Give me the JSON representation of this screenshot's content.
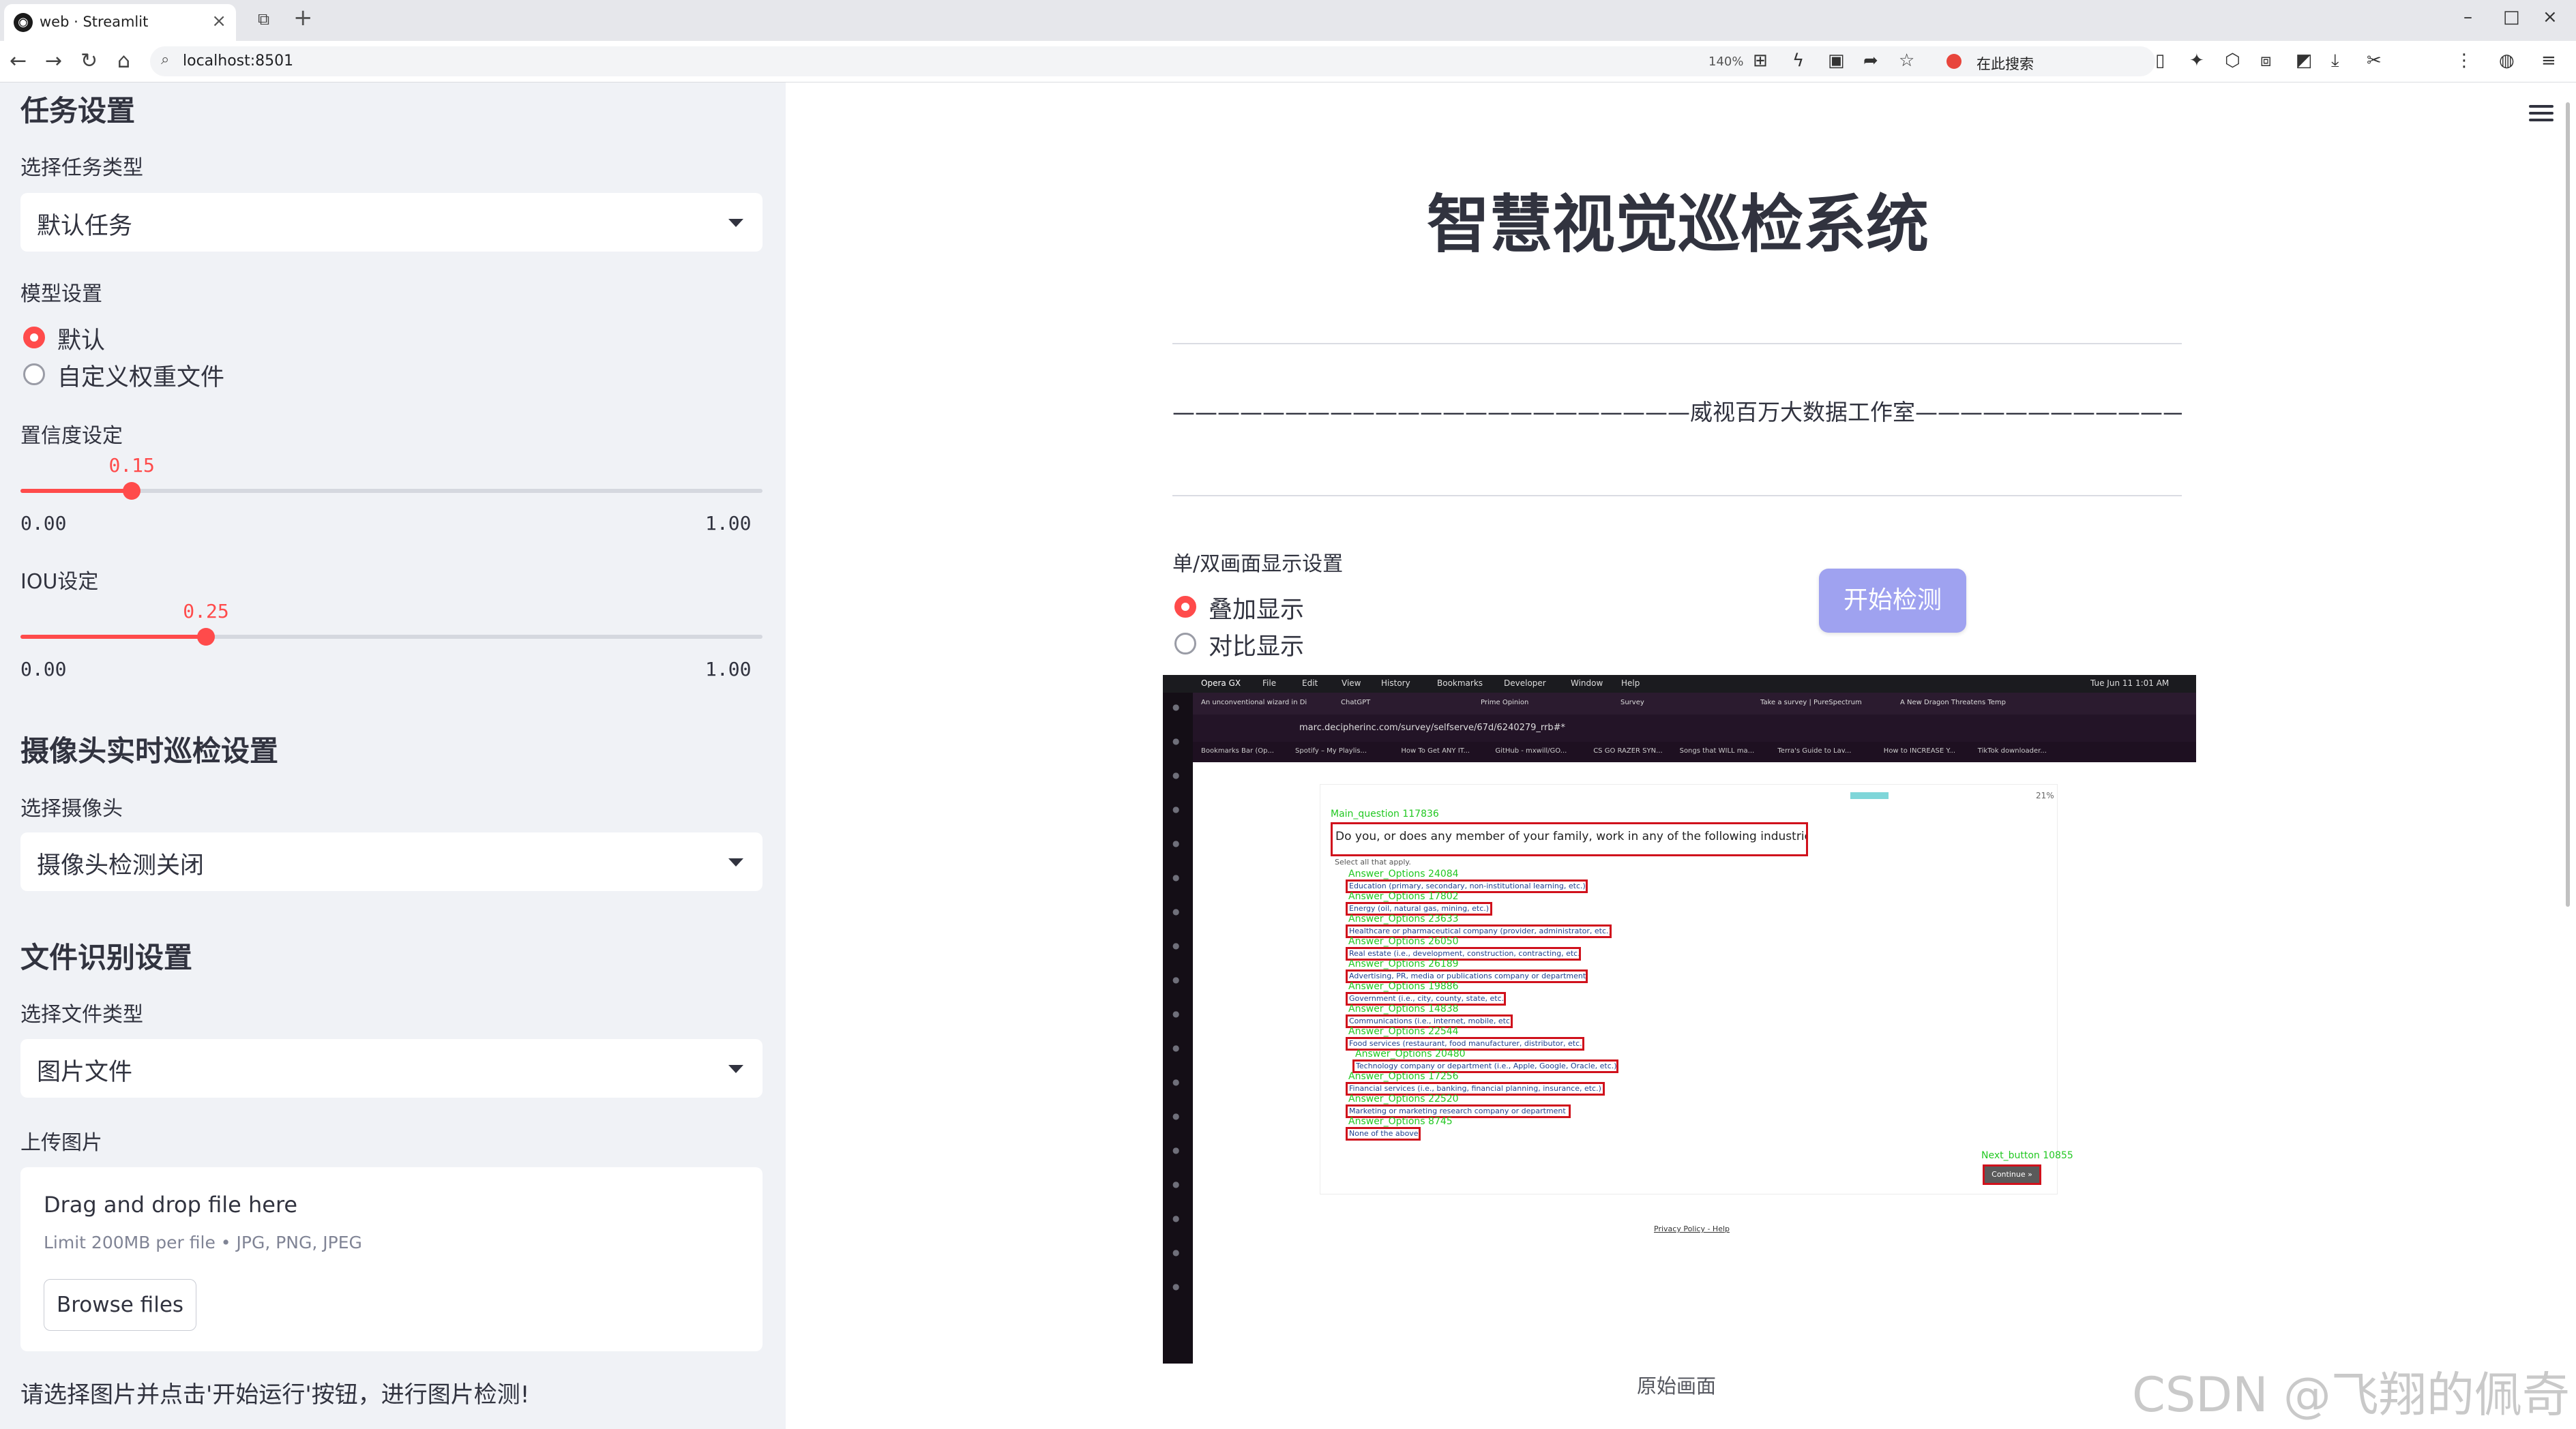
{
  "browser": {
    "tab_title": "web · Streamlit",
    "tab_favicon": "◉",
    "url": "localhost:8501",
    "zoom": "140%",
    "search_placeholder": "在此搜索"
  },
  "sidebar": {
    "task_heading": "任务设置",
    "task_type_label": "选择任务类型",
    "task_type_value": "默认任务",
    "model_heading": "模型设置",
    "model_options": [
      "默认",
      "自定义权重文件"
    ],
    "model_selected": "默认",
    "conf_label": "置信度设定",
    "conf_value": "0.15",
    "conf_level": 0.15,
    "conf_min": "0.00",
    "conf_max": "1.00",
    "iou_label": "IOU设定",
    "iou_value": "0.25",
    "iou_level": 0.25,
    "iou_min": "0.00",
    "iou_max": "1.00",
    "camera_heading": "摄像头实时巡检设置",
    "camera_label": "选择摄像头",
    "camera_value": "摄像头检测关闭",
    "file_heading": "文件识别设置",
    "file_type_label": "选择文件类型",
    "file_type_value": "图片文件",
    "upload_label": "上传图片",
    "drop_title": "Drag and drop file here",
    "drop_limit": "Limit 200MB per file • JPG, PNG, JPEG",
    "browse_label": "Browse files",
    "hint": "请选择图片并点击'开始运行'按钮，进行图片检测!"
  },
  "main": {
    "title": "智慧视觉巡检系统",
    "studio_line": "———————————————————————威视百万大数据工作室———————————————————————",
    "display_label": "单/双画面显示设置",
    "display_options": [
      "叠加显示",
      "对比显示"
    ],
    "display_selected": "叠加显示",
    "start_button": "开始检测",
    "caption": "原始画面",
    "watermark": "CSDN @飞翔的佩奇",
    "accent_color": "#ff4b4b",
    "button_color": "#9fa2f0"
  },
  "screenshot": {
    "menubar": [
      "Opera GX",
      "File",
      "Edit",
      "View",
      "History",
      "Bookmarks",
      "Developer",
      "Window",
      "Help"
    ],
    "clock": "Tue Jun 11  1:01 AM",
    "tabs": [
      "An unconventional wizard in Di",
      "ChatGPT",
      "Prime Opinion",
      "Survey",
      "Take a survey | PureSpectrum",
      "A New Dragon Threatens Temp"
    ],
    "address": "marc.decipherinc.com/survey/selfserve/67d/6240279_rrb#*",
    "bookmarks": [
      "Bookmarks Bar (Op...",
      "Spotify – My Playlis...",
      "How To Get ANY IT...",
      "GitHub - mxwill/GO...",
      "CS GO RAZER SYN...",
      "Songs that WILL ma...",
      "Terra's Guide to Lav...",
      "How to INCREASE Y...",
      "TikTok downloader..."
    ],
    "progress": "21%",
    "question_label": "Main_question  117836",
    "question_text": "Do you, or does any member of your family, work in any of the following industries?",
    "select_all": "Select all that apply.",
    "options": [
      {
        "label": "Answer_Options  24084",
        "text": "Education (primary, secondary, non-institutional learning, etc.)"
      },
      {
        "label": "Answer_Options  17802",
        "text": "Energy (oil, natural gas, mining, etc.)"
      },
      {
        "label": "Answer_Options  23633",
        "text": "Healthcare or pharmaceutical company (provider, administrator, etc.)"
      },
      {
        "label": "Answer_Options  26050",
        "text": "Real estate (i.e., development, construction, contracting, etc.)"
      },
      {
        "label": "Answer_Options  26189",
        "text": "Advertising, PR, media or publications company or department"
      },
      {
        "label": "Answer_Options  19886",
        "text": "Government (i.e., city, county, state, etc.)"
      },
      {
        "label": "Answer_Options  14838",
        "text": "Communications (i.e., internet, mobile, etc.)"
      },
      {
        "label": "Answer_Options  22544",
        "text": "Food services (restaurant, food manufacturer, distributor, etc.)"
      },
      {
        "label": "Answer_Options  20480",
        "text": "Technology company or department (i.e., Apple, Google, Oracle, etc.)"
      },
      {
        "label": "Answer_Options  17256",
        "text": "Financial services (i.e., banking, financial planning, insurance, etc.)"
      },
      {
        "label": "Answer_Options  22520",
        "text": "Marketing or marketing research company or department"
      },
      {
        "label": "Answer_Options  8745",
        "text": "None of the above"
      }
    ],
    "next_label": "Next_button  10855",
    "next_text": "Continue »",
    "footer": "Privacy Policy - Help"
  }
}
